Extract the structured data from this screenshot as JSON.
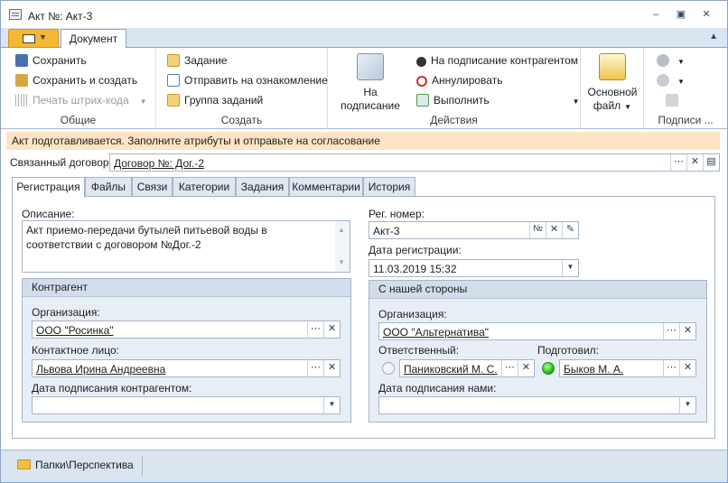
{
  "window": {
    "title": "Акт №: Акт-3"
  },
  "ribbon": {
    "tab": "Документ",
    "groups": {
      "general": {
        "label": "Общие",
        "save": "Сохранить",
        "save_create": "Сохранить и создать",
        "print_barcode": "Печать штрих-кода"
      },
      "create": {
        "label": "Создать",
        "task": "Задание",
        "send_review": "Отправить на ознакомление",
        "task_group": "Группа заданий"
      },
      "actions": {
        "label": "Действия",
        "sign": "На подписание",
        "sign_counterparty": "На подписание контрагентом",
        "cancel": "Аннулировать",
        "execute": "Выполнить"
      },
      "main_file": {
        "line1": "Основной",
        "line2": "файл"
      },
      "signatures": {
        "label": "Подписи ..."
      }
    }
  },
  "status_message": "Акт подготавливается. Заполните атрибуты и отправьте на согласование",
  "related_contract": {
    "label": "Связанный договор:",
    "value": "Договор №: Дог.-2"
  },
  "tabs": [
    "Регистрация",
    "Файлы",
    "Связи",
    "Категории",
    "Задания",
    "Комментарии",
    "История"
  ],
  "registration": {
    "description": {
      "label": "Описание:",
      "value": "Акт приемо-передачи бутылей питьевой воды в соответствии с договором №Дог.-2"
    },
    "reg_number": {
      "label": "Рег. номер:",
      "value": "Акт-3",
      "num_sign": "№"
    },
    "reg_date": {
      "label": "Дата регистрации:",
      "value": "11.03.2019 15:32"
    },
    "counterparty": {
      "title": "Контрагент",
      "org_label": "Организация:",
      "org_value": "ООО \"Росинка\"",
      "contact_label": "Контактное лицо:",
      "contact_value": "Львова Ирина Андреевна",
      "sign_date_label": "Дата подписания контрагентом:",
      "sign_date_value": ""
    },
    "our_side": {
      "title": "С нашей стороны",
      "org_label": "Организация:",
      "org_value": "ООО \"Альтернатива\"",
      "responsible_label": "Ответственный:",
      "responsible_value": "Паниковский М. С.",
      "prepared_label": "Подготовил:",
      "prepared_value": "Быков М. А.",
      "sign_date_label": "Дата подписания  нами:",
      "sign_date_value": ""
    }
  },
  "footer": {
    "folder": "Папки\\Перспектива"
  },
  "colors": {
    "accent": "#f5b835",
    "status_bg": "#fde4c4",
    "panel_bg": "#e8eef6"
  }
}
